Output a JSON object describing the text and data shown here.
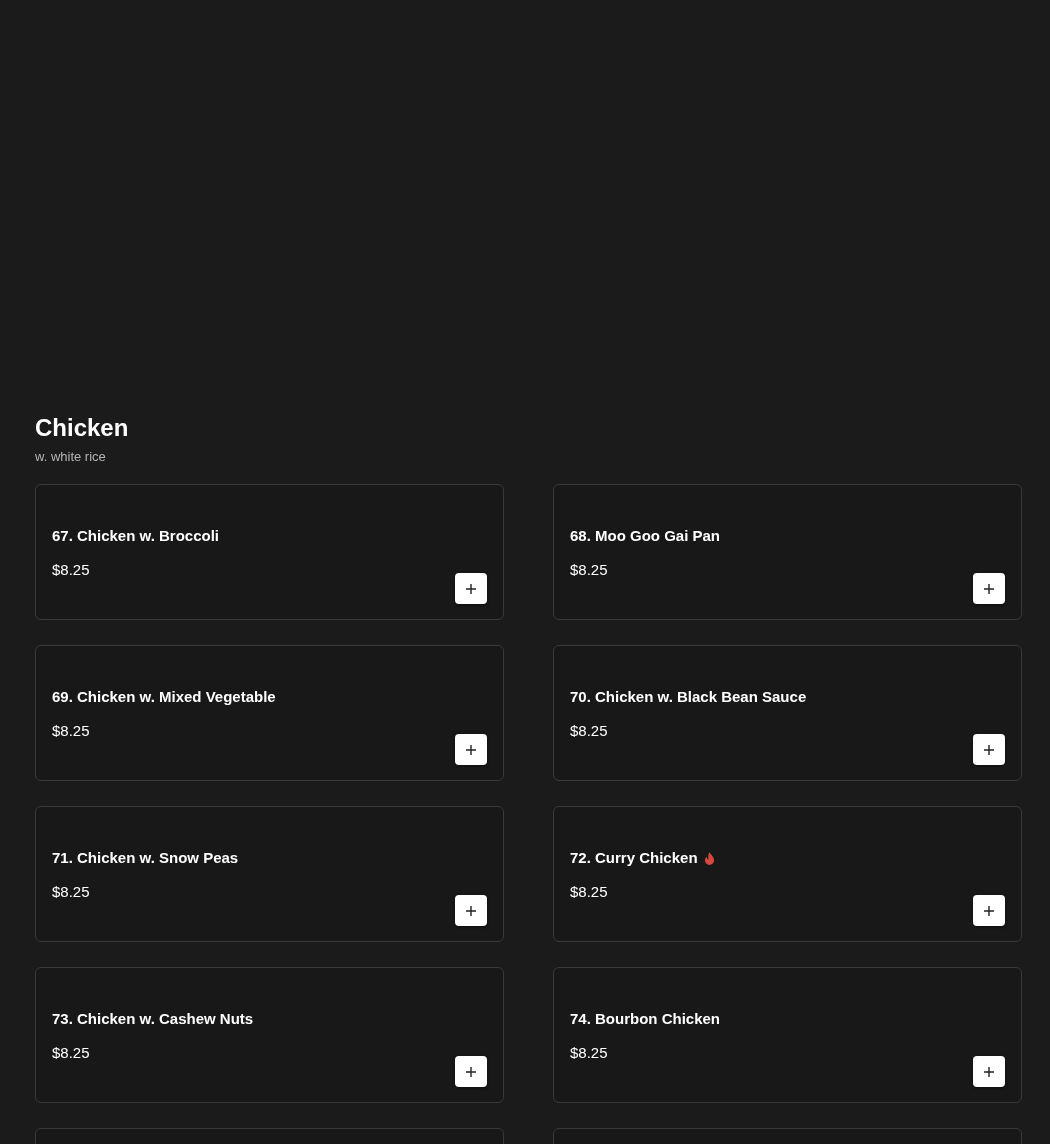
{
  "section": {
    "title": "Chicken",
    "subtitle": "w. white rice"
  },
  "items": [
    {
      "kind": "dish",
      "name": "67. Chicken w. Broccoli",
      "price": "$8.25",
      "spicy": false
    },
    {
      "kind": "dish",
      "name": "68. Moo Goo Gai Pan",
      "price": "$8.25",
      "spicy": false
    },
    {
      "kind": "dish",
      "name": "69. Chicken w. Mixed Vegetable",
      "price": "$8.25",
      "spicy": false
    },
    {
      "kind": "dish",
      "name": "70. Chicken w. Black Bean Sauce",
      "price": "$8.25",
      "spicy": false
    },
    {
      "kind": "dish",
      "name": "71. Chicken w. Snow Peas",
      "price": "$8.25",
      "spicy": false
    },
    {
      "kind": "dish",
      "name": "72. Curry Chicken",
      "price": "$8.25",
      "spicy": true
    },
    {
      "kind": "dish",
      "name": "73. Chicken w. Cashew Nuts",
      "price": "$8.25",
      "spicy": false
    },
    {
      "kind": "dish",
      "name": "74. Bourbon Chicken",
      "price": "$8.25",
      "spicy": false
    },
    {
      "kind": "cut"
    },
    {
      "kind": "cut"
    }
  ]
}
